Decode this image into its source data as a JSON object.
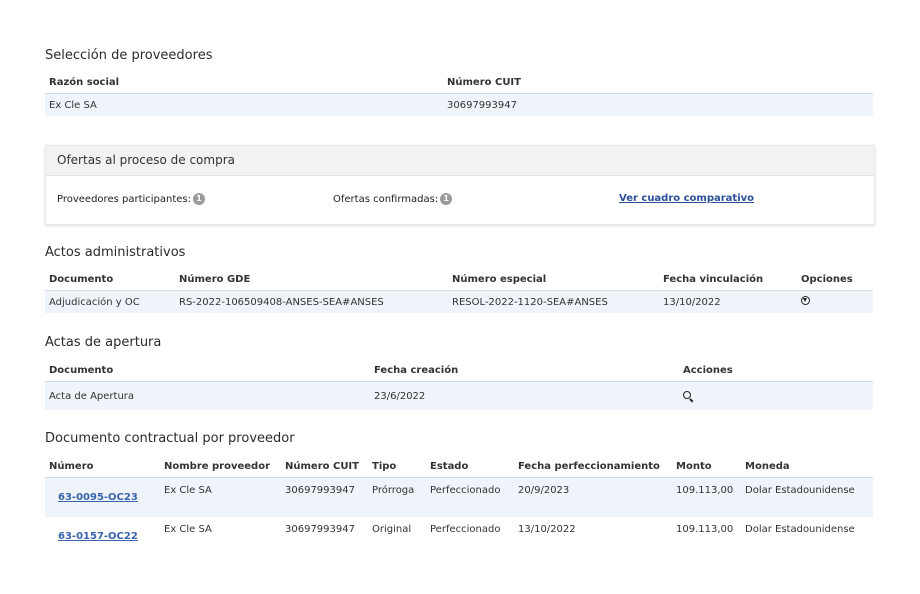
{
  "proveedores": {
    "title": "Selección de proveedores",
    "headers": [
      "Razón social",
      "Número CUIT"
    ],
    "rows": [
      [
        "Ex Cle SA",
        "30697993947"
      ]
    ]
  },
  "ofertas": {
    "title": "Ofertas al proceso de compra",
    "participantes_label": "Proveedores participantes:",
    "participantes_count": "1",
    "confirmadas_label": "Ofertas confirmadas:",
    "confirmadas_count": "1",
    "cuadro_link": "Ver cuadro comparativo"
  },
  "actos": {
    "title": "Actos administrativos",
    "headers": [
      "Documento",
      "Número GDE",
      "Número especial",
      "Fecha vinculación",
      "Opciones"
    ],
    "rows": [
      [
        "Adjudicación y OC",
        "RS-2022-106509408-ANSES-SEA#ANSES",
        "RESOL-2022-1120-SEA#ANSES",
        "13/10/2022"
      ]
    ],
    "option_icon": "download-icon"
  },
  "actas": {
    "title": "Actas de apertura",
    "headers": [
      "Documento",
      "Fecha creación",
      "Acciones"
    ],
    "rows": [
      [
        "Acta de Apertura",
        "23/6/2022"
      ]
    ],
    "action_icon": "search-icon"
  },
  "contractual": {
    "title": "Documento contractual por proveedor",
    "headers": [
      "Número",
      "Nombre proveedor",
      "Número CUIT",
      "Tipo",
      "Estado",
      "Fecha perfeccionamiento",
      "Monto",
      "Moneda"
    ],
    "rows": [
      [
        "63-0095-OC23",
        "Ex Cle SA",
        "30697993947",
        "Prórroga",
        "Perfeccionado",
        "20/9/2023",
        "109.113,00",
        "Dolar Estadounidense"
      ],
      [
        "63-0157-OC22",
        "Ex Cle SA",
        "30697993947",
        "Original",
        "Perfeccionado",
        "13/10/2022",
        "109.113,00",
        "Dolar Estadounidense"
      ]
    ]
  }
}
